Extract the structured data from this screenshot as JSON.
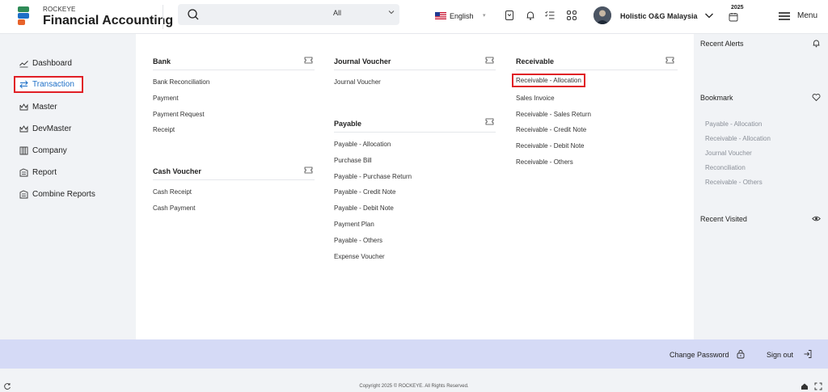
{
  "header": {
    "brand_small": "ROCKEYE",
    "brand_big": "Financial Accounting",
    "search_placeholder": "",
    "search_category": "All",
    "language": "English",
    "company": "Holistic O&G Malaysia",
    "year": "2025",
    "menu_label": "Menu"
  },
  "nav": {
    "items": [
      {
        "label": "Dashboard",
        "icon": "trend-icon"
      },
      {
        "label": "Transaction",
        "icon": "exchange-icon"
      },
      {
        "label": "Master",
        "icon": "crown-icon"
      },
      {
        "label": "DevMaster",
        "icon": "crown-icon"
      },
      {
        "label": "Company",
        "icon": "building-icon"
      },
      {
        "label": "Report",
        "icon": "report-icon"
      },
      {
        "label": "Combine Reports",
        "icon": "report-icon"
      }
    ]
  },
  "columns": {
    "bank": {
      "title": "Bank",
      "links": [
        "Bank Reconciliation",
        "Payment",
        "Payment Request",
        "Receipt"
      ]
    },
    "cash": {
      "title": "Cash Voucher",
      "links": [
        "Cash Receipt",
        "Cash Payment"
      ]
    },
    "journal": {
      "title": "Journal Voucher",
      "links": [
        "Journal Voucher"
      ]
    },
    "payable": {
      "title": "Payable",
      "links": [
        "Payable - Allocation",
        "Purchase Bill",
        "Payable - Purchase Return",
        "Payable - Credit Note",
        "Payable - Debit Note",
        "Payment Plan",
        "Payable - Others",
        "Expense Voucher"
      ]
    },
    "receivable": {
      "title": "Receivable",
      "links": [
        "Receivable - Allocation",
        "Sales Invoice",
        "Receivable - Sales Return",
        "Receivable - Credit Note",
        "Receivable - Debit Note",
        "Receivable - Others"
      ]
    }
  },
  "right": {
    "alerts_title": "Recent Alerts",
    "bookmark_title": "Bookmark",
    "bookmarks": [
      "Payable - Allocation",
      "Receivable - Allocation",
      "Journal Voucher",
      "Reconciliation",
      "Receivable - Others"
    ],
    "visited_title": "Recent Visited"
  },
  "footer": {
    "change_password": "Change Password",
    "sign_out": "Sign out",
    "copyright": "Copyright 2025 © ROCKEYE. All Rights Reserved."
  },
  "colors": {
    "accent": "#1e6fc7",
    "highlight_border": "#e01f26",
    "footer_bar": "#d5daf6"
  }
}
